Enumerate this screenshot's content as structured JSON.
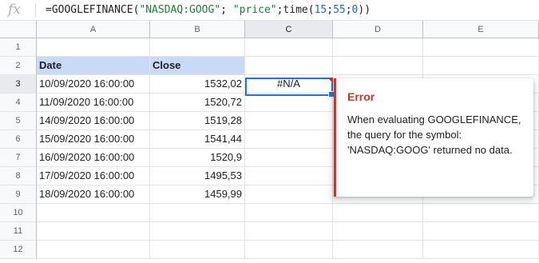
{
  "formula_bar": {
    "icon": "fx-icon",
    "parts": [
      {
        "text": "=GOOGLEFINANCE(",
        "kind": "plain"
      },
      {
        "text": "\"NASDAQ:GOOG\"",
        "kind": "str"
      },
      {
        "text": "; ",
        "kind": "plain"
      },
      {
        "text": "\"price\"",
        "kind": "str"
      },
      {
        "text": ";time(",
        "kind": "plain"
      },
      {
        "text": "15",
        "kind": "num"
      },
      {
        "text": ";",
        "kind": "plain"
      },
      {
        "text": "55",
        "kind": "num"
      },
      {
        "text": ";",
        "kind": "plain"
      },
      {
        "text": "0",
        "kind": "num"
      },
      {
        "text": "))",
        "kind": "plain"
      }
    ]
  },
  "columns": [
    "A",
    "B",
    "C",
    "D",
    "E"
  ],
  "rows": [
    "1",
    "2",
    "3",
    "4",
    "5",
    "6",
    "7",
    "8",
    "9",
    "10",
    "11",
    "12"
  ],
  "cells": {
    "A2": "Date",
    "B2": "Close",
    "A3": "10/09/2020 16:00:00",
    "B3": "1532,02",
    "C3": "#N/A",
    "A4": "11/09/2020 16:00:00",
    "B4": "1520,72",
    "A5": "14/09/2020 16:00:00",
    "B5": "1519,28",
    "A6": "15/09/2020 16:00:00",
    "B6": "1541,44",
    "A7": "16/09/2020 16:00:00",
    "B7": "1520,9",
    "A8": "17/09/2020 16:00:00",
    "B8": "1495,53",
    "A9": "18/09/2020 16:00:00",
    "B9": "1459,99"
  },
  "active_cell": {
    "column": "C",
    "row": "3"
  },
  "error_popup": {
    "title": "Error",
    "message": "When evaluating GOOGLEFINANCE, the query for the symbol: 'NASDAQ:GOOG' returned no data."
  },
  "colors": {
    "header_fill": "#c9daf8",
    "selection": "#1a73e8",
    "error": "#d93025"
  }
}
